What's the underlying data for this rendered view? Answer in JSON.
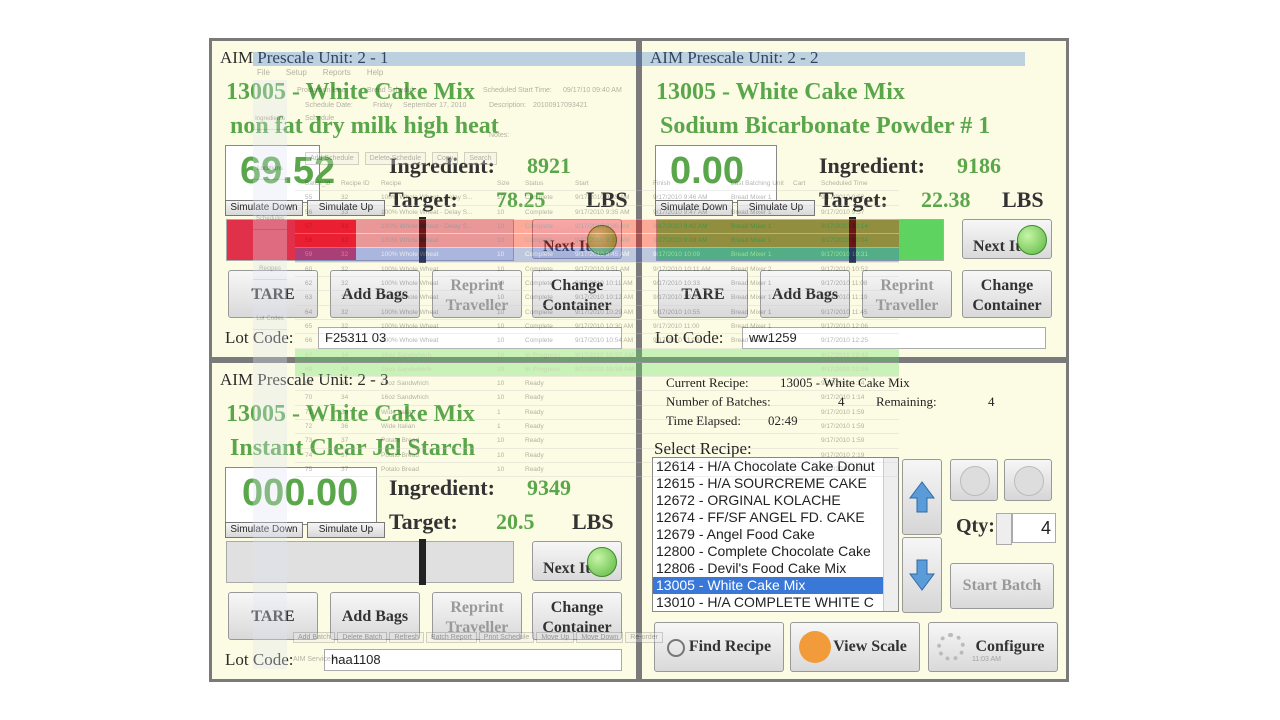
{
  "units": [
    {
      "title": "AIM Prescale Unit:  2 - 1",
      "recipe": "13005 - White Cake Mix",
      "ingredient_name": "non fat dry milk high heat",
      "weight": "69.52",
      "ingredient_label": "Ingredient:",
      "ingredient_id": "8921",
      "target_label": "Target:",
      "target_value": "78.25",
      "unit": "LBS",
      "lot_label": "Lot Code:",
      "lot_code": "F25311 03",
      "progress_color": "#e0304a",
      "progress_fraction": 0.45
    },
    {
      "title": "AIM Prescale Unit:  2 - 2",
      "recipe": "13005 - White Cake Mix",
      "ingredient_name": "Sodium Bicarbonate Powder # 1",
      "weight": "0.00",
      "ingredient_label": "Ingredient:",
      "ingredient_id": "9186",
      "target_label": "Target:",
      "target_value": "22.38",
      "unit": "LBS",
      "lot_label": "Lot Code:",
      "lot_code": "ww1259",
      "progress_color": "#5fd35f",
      "progress_fraction": 1.0
    },
    {
      "title": "AIM Prescale Unit:  2 - 3",
      "recipe": "13005 - White Cake Mix",
      "ingredient_name": "Instant Clear Jel Starch",
      "weight": "000.00",
      "ingredient_label": "Ingredient:",
      "ingredient_id": "9349",
      "target_label": "Target:",
      "target_value": "20.5",
      "unit": "LBS",
      "lot_label": "Lot Code:",
      "lot_code": "haa1108",
      "progress_color": "#cccccc",
      "progress_fraction": 0.0
    }
  ],
  "buttons": {
    "simulate_down": "Simulate Down",
    "simulate_up": "Simulate Up",
    "next_item": "Next Item",
    "tare": "TARE",
    "add_bags": "Add Bags",
    "reprint_traveller": "Reprint Traveller",
    "change_container": "Change Container"
  },
  "control": {
    "current_recipe_label": "Current Recipe:",
    "current_recipe": "13005 - White Cake Mix",
    "batches_label": "Number of Batches:",
    "batches": "4",
    "remaining_label": "Remaining:",
    "remaining": "4",
    "elapsed_label": "Time Elapsed:",
    "elapsed": "02:49",
    "select_recipe_label": "Select Recipe:",
    "recipes": [
      "12614 - H/A Chocolate Cake Donut",
      "12615 - H/A SOURCREME CAKE",
      "12672 - ORGINAL KOLACHE",
      "12674 - FF/SF ANGEL FD. CAKE",
      "12679 - Angel Food Cake",
      "12800 - Complete Chocolate Cake",
      "12806 - Devil's Food Cake Mix",
      "13005 - White Cake Mix",
      "13010 - H/A COMPLETE WHITE C"
    ],
    "selected_index": 7,
    "qty_label": "Qty:",
    "qty": "4",
    "start_batch": "Start Batch",
    "find_recipe": "Find Recipe",
    "view_scale": "View Scale",
    "configure": "Configure"
  },
  "overlay": {
    "menu": [
      "File",
      "Setup",
      "Reports",
      "Help"
    ],
    "sidebar": [
      "Ingredients",
      "Locations",
      "Schedules",
      "Recipes",
      "Lot Codes"
    ],
    "production_line_label": "Production Line:",
    "production_line": "Bread Schedule",
    "schedule_date_label": "Schedule Date:",
    "schedule_day": "Friday",
    "schedule_date": "September 17, 2010",
    "scheduled_start_label": "Scheduled Start Time:",
    "scheduled_start": "09/17/10 09:40 AM",
    "description_label": "Description:",
    "description": "20100917093421",
    "notes_label": "Notes:",
    "schedule_label": "Schedule",
    "toolbar": [
      "Add Schedule",
      "Delete Schedule",
      "Copy",
      "Search"
    ],
    "columns": [
      "Batch_id",
      "Recipe ID",
      "Recipe",
      "Size",
      "Status",
      "Start",
      "Finish",
      "Last Batching Unit",
      "Cart",
      "Scheduled Time"
    ],
    "rows": [
      [
        "55",
        "32",
        "100% Whole Wheat - Delay S...",
        "10",
        "Complete",
        "9/17/2010 9:35 AM",
        "9/17/2010 9:46 AM",
        "Bread Mixer 1",
        "",
        "9/17/2010 9:52"
      ],
      [
        "56",
        "33",
        "100% Whole Wheat - Delay S...",
        "10",
        "Complete",
        "9/17/2010 9:35 AM",
        "9/17/2010 9:47 AM",
        "Bread Mixer 1",
        "",
        "9/17/2010 9:57"
      ],
      [
        "57",
        "33",
        "100% Whole Wheat - Delay S...",
        "10",
        "Complete",
        "9/17/2010 9:36 AM",
        "9/17/2010 9:42 AM",
        "Bread Mixer 1",
        "",
        "9/17/2010 10:14"
      ],
      [
        "58",
        "32",
        "100% Whole Wheat",
        "10",
        "Complete",
        "9/17/2010 9:37 AM",
        "9/17/2010 9:48 AM",
        "Bread Mixer 1",
        "",
        "9/17/2010 10:04"
      ],
      [
        "59",
        "32",
        "100% Whole Wheat",
        "10",
        "Complete",
        "9/17/2010 9:45 AM",
        "9/17/2010 10:09",
        "Bread Mixer 1",
        "",
        "9/17/2010 10:31"
      ],
      [
        "60",
        "32",
        "100% Whole Wheat",
        "10",
        "Complete",
        "9/17/2010 9:51 AM",
        "9/17/2010 10:11 AM",
        "Bread Mixer 2",
        "",
        "9/17/2010 10:52"
      ],
      [
        "62",
        "32",
        "100% Whole Wheat",
        "10",
        "Complete",
        "9/17/2010 10:11 AM",
        "9/17/2010 10:33",
        "Bread Mixer 1",
        "",
        "9/17/2010 11:08"
      ],
      [
        "63",
        "32",
        "100% Whole Wheat",
        "10",
        "Complete",
        "9/17/2010 10:12 AM",
        "9/17/2010 10:50",
        "Bread Mixer 1",
        "",
        "9/17/2010 11:19"
      ],
      [
        "64",
        "32",
        "100% Whole Wheat",
        "10",
        "Complete",
        "9/17/2010 10:29 AM",
        "9/17/2010 10:55",
        "Bread Mixer 1",
        "",
        "9/17/2010 11:45"
      ],
      [
        "65",
        "32",
        "100% Whole Wheat",
        "10",
        "Complete",
        "9/17/2010 10:30 AM",
        "9/17/2010 11:00",
        "Bread Mixer 1",
        "",
        "9/17/2010 12:06"
      ],
      [
        "66",
        "32",
        "100% Whole Wheat",
        "10",
        "Complete",
        "9/17/2010 10:54 AM",
        "9/17/2010 11:03",
        "Bread Mixer 1",
        "",
        "9/17/2010 12:25"
      ],
      [
        "67",
        "34",
        "16oz Sandwhich",
        "10",
        "In Progress",
        "9/17/2010 10:57 AM",
        "",
        "",
        "",
        "9/17/2010 12:42"
      ],
      [
        "68",
        "34",
        "16oz Sandwhich",
        "10",
        "In Progress",
        "9/17/2010 10:59 AM",
        "",
        "",
        "",
        "9/17/2010 12:59"
      ],
      [
        "69",
        "34",
        "16oz Sandwhich",
        "10",
        "Ready",
        "",
        "",
        "",
        "",
        "9/17/2010 1:14"
      ],
      [
        "70",
        "34",
        "16oz Sandwhich",
        "10",
        "Ready",
        "",
        "",
        "",
        "",
        "9/17/2010 1:14"
      ],
      [
        "71",
        "36",
        "Wide Italian",
        "1",
        "Ready",
        "",
        "",
        "",
        "",
        "9/17/2010 1:59"
      ],
      [
        "72",
        "36",
        "Wide Italian",
        "1",
        "Ready",
        "",
        "",
        "",
        "",
        "9/17/2010 1:59"
      ],
      [
        "73",
        "37",
        "Potato Bread",
        "10",
        "Ready",
        "",
        "",
        "",
        "",
        "9/17/2010 1:59"
      ],
      [
        "74",
        "37",
        "Potato Bread",
        "10",
        "Ready",
        "",
        "",
        "",
        "",
        "9/17/2010 2:19"
      ],
      [
        "75",
        "37",
        "Potato Bread",
        "10",
        "Ready",
        "",
        "",
        "",
        "",
        "9/17/2010 2:39"
      ]
    ],
    "bottom_buttons": [
      "Add Batch",
      "Delete Batch",
      "Refresh",
      "Batch Report",
      "Print Schedule",
      "Move Up",
      "Move Down",
      "Re-order"
    ],
    "status": "AIM Service R...",
    "clock": "11:03 AM"
  }
}
